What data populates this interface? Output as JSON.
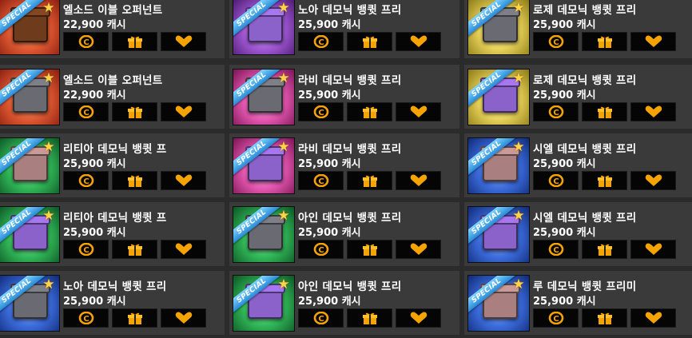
{
  "ribbon_label": "SPECIAL",
  "buttons": {
    "buy_icon": "coin-icon",
    "gift_icon": "gift-icon",
    "wish_icon": "heart-icon"
  },
  "colors": {
    "button_icon": "#f5a300",
    "cell_bg": "#3a3a3a",
    "page_bg": "#2b2b2b"
  },
  "items": [
    {
      "name": "엘소드 이블 오퍼넌트",
      "price": "22,900 캐시"
    },
    {
      "name": "노아 데모닉 뱅큇 프리",
      "price": "25,900 캐시"
    },
    {
      "name": "로제 데모닉 뱅큇 프리",
      "price": "25,900 캐시"
    },
    {
      "name": "엘소드 이블 오퍼넌트",
      "price": "22,900 캐시"
    },
    {
      "name": "라비 데모닉 뱅큇 프리",
      "price": "25,900 캐시"
    },
    {
      "name": "로제 데모닉 뱅큇 프리",
      "price": "25,900 캐시"
    },
    {
      "name": "리티아 데모닉 뱅큇 프",
      "price": "25,900 캐시"
    },
    {
      "name": "라비 데모닉 뱅큇 프리",
      "price": "25,900 캐시"
    },
    {
      "name": "시엘 데모닉 뱅큇 프리",
      "price": "25,900 캐시"
    },
    {
      "name": "리티아 데모닉 뱅큇 프",
      "price": "25,900 캐시"
    },
    {
      "name": "아인 데모닉 뱅큇 프리",
      "price": "25,900 캐시"
    },
    {
      "name": "시엘 데모닉 뱅큇 프리",
      "price": "25,900 캐시"
    },
    {
      "name": "노아 데모닉 뱅큇 프리",
      "price": "25,900 캐시"
    },
    {
      "name": "아인 데모닉 뱅큇 프리",
      "price": "25,900 캐시"
    },
    {
      "name": "루 데모닉 뱅큇 프리미",
      "price": "25,900 캐시"
    }
  ]
}
